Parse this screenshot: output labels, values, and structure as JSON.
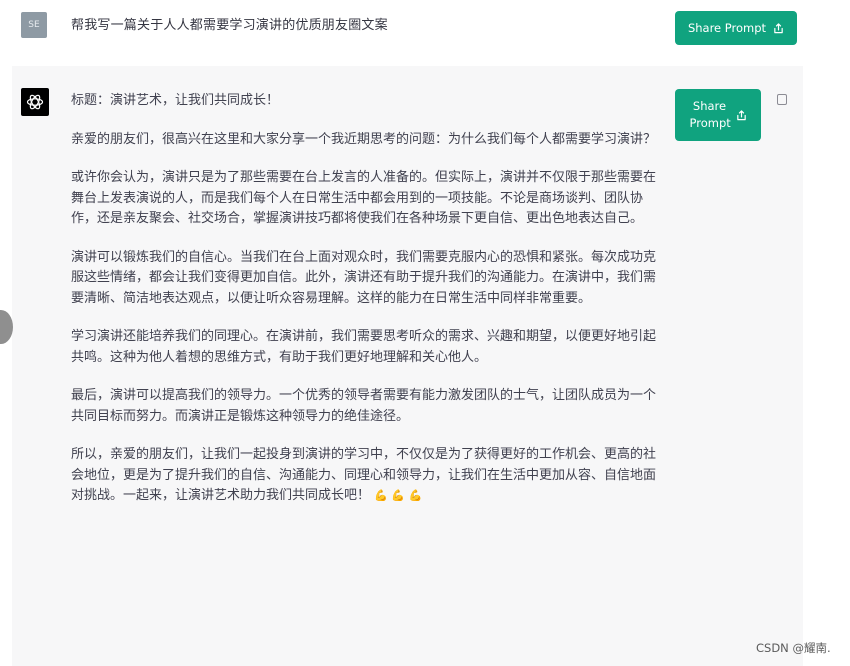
{
  "user_message": {
    "avatar_initials": "SE",
    "text": "帮我写一篇关于人人都需要学习演讲的优质朋友圈文案"
  },
  "share_button_label": "Share Prompt",
  "share_button_side": {
    "line1": "Share",
    "line2": "Prompt"
  },
  "assistant_message": {
    "title": "标题：演讲艺术，让我们共同成长！",
    "paragraphs": [
      "亲爱的朋友们，很高兴在这里和大家分享一个我近期思考的问题：为什么我们每个人都需要学习演讲？",
      "或许你会认为，演讲只是为了那些需要在台上发言的人准备的。但实际上，演讲并不仅限于那些需要在舞台上发表演说的人，而是我们每个人在日常生活中都会用到的一项技能。不论是商场谈判、团队协作，还是亲友聚会、社交场合，掌握演讲技巧都将使我们在各种场景下更自信、更出色地表达自己。",
      "演讲可以锻炼我们的自信心。当我们在台上面对观众时，我们需要克服内心的恐惧和紧张。每次成功克服这些情绪，都会让我们变得更加自信。此外，演讲还有助于提升我们的沟通能力。在演讲中，我们需要清晰、简洁地表达观点，以便让听众容易理解。这样的能力在日常生活中同样非常重要。",
      "学习演讲还能培养我们的同理心。在演讲前，我们需要思考听众的需求、兴趣和期望，以便更好地引起共鸣。这种为他人着想的思维方式，有助于我们更好地理解和关心他人。",
      "最后，演讲可以提高我们的领导力。一个优秀的领导者需要有能力激发团队的士气，让团队成员为一个共同目标而努力。而演讲正是锻炼这种领导力的绝佳途径。",
      "所以，亲爱的朋友们，让我们一起投身到演讲的学习中，不仅仅是为了获得更好的工作机会、更高的社会地位，更是为了提升我们的自信、沟通能力、同理心和领导力，让我们在生活中更加从容、自信地面对挑战。一起来，让演讲艺术助力我们共同成长吧！"
    ],
    "emoji": "💪 💪 💪"
  },
  "watermark": "CSDN @耀南.",
  "icons": {
    "share": "share-icon",
    "copy": "copy-icon",
    "assistant_logo": "openai-logo-icon"
  },
  "colors": {
    "accent": "#10a37f",
    "assistant_bg": "#f7f7f8",
    "avatar_user": "#8e9aa4"
  }
}
